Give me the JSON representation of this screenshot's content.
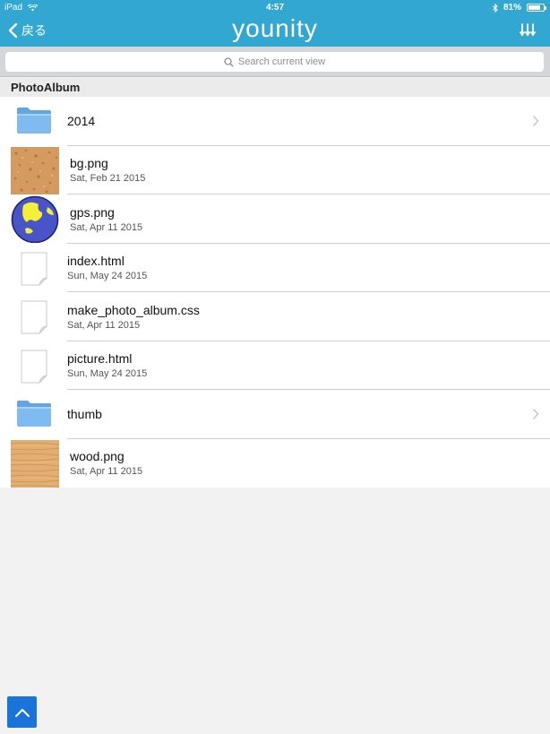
{
  "status": {
    "device": "iPad",
    "time": "4:57",
    "battery": "81%",
    "battery_level": 0.81
  },
  "nav": {
    "back_label": "戻る",
    "brand": "younity"
  },
  "search": {
    "placeholder": "Search current view"
  },
  "section": {
    "title": "PhotoAlbum"
  },
  "items": [
    {
      "name": "2014",
      "date": "",
      "kind": "folder"
    },
    {
      "name": "bg.png",
      "date": "Sat, Feb 21 2015",
      "kind": "image-cork"
    },
    {
      "name": "gps.png",
      "date": "Sat, Apr 11 2015",
      "kind": "image-globe"
    },
    {
      "name": "index.html",
      "date": "Sun, May 24 2015",
      "kind": "document"
    },
    {
      "name": "make_photo_album.css",
      "date": "Sat, Apr 11 2015",
      "kind": "document"
    },
    {
      "name": "picture.html",
      "date": "Sun, May 24 2015",
      "kind": "document"
    },
    {
      "name": "thumb",
      "date": "",
      "kind": "folder"
    },
    {
      "name": "wood.png",
      "date": "Sat, Apr 11 2015",
      "kind": "image-wood"
    }
  ],
  "colors": {
    "header": "#31a7d1",
    "scroll_button": "#1a73d9"
  }
}
